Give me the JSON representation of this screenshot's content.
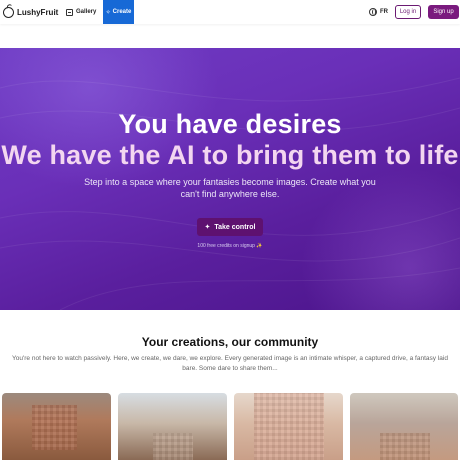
{
  "nav": {
    "brand": "LushyFruit",
    "gallery_label": "Gallery",
    "create_label": "Create",
    "lang_label": "FR",
    "login_label": "Log in",
    "signup_label": "Sign up"
  },
  "hero": {
    "title_line1": "You have desires",
    "title_line2": "We have the AI to bring them to life",
    "subtitle": "Step into a space where your fantasies become images. Create what you can't find anywhere else.",
    "cta_label": "Take control",
    "note": "100 free credits on signup ✨"
  },
  "community": {
    "title": "Your creations, our community",
    "text": "You're not here to watch passively. Here, we create, we dare, we explore. Every generated image is an intimate whisper, a captured drive, a fantasy laid bare. Some dare to share them..."
  },
  "colors": {
    "accent_blue": "#1769d6",
    "brand_purple": "#7a1a7e",
    "hero_purple": "#6a2fb8"
  },
  "icons": [
    "logo-icon",
    "gallery-icon",
    "create-icon",
    "globe-icon",
    "sparkles-icon"
  ]
}
